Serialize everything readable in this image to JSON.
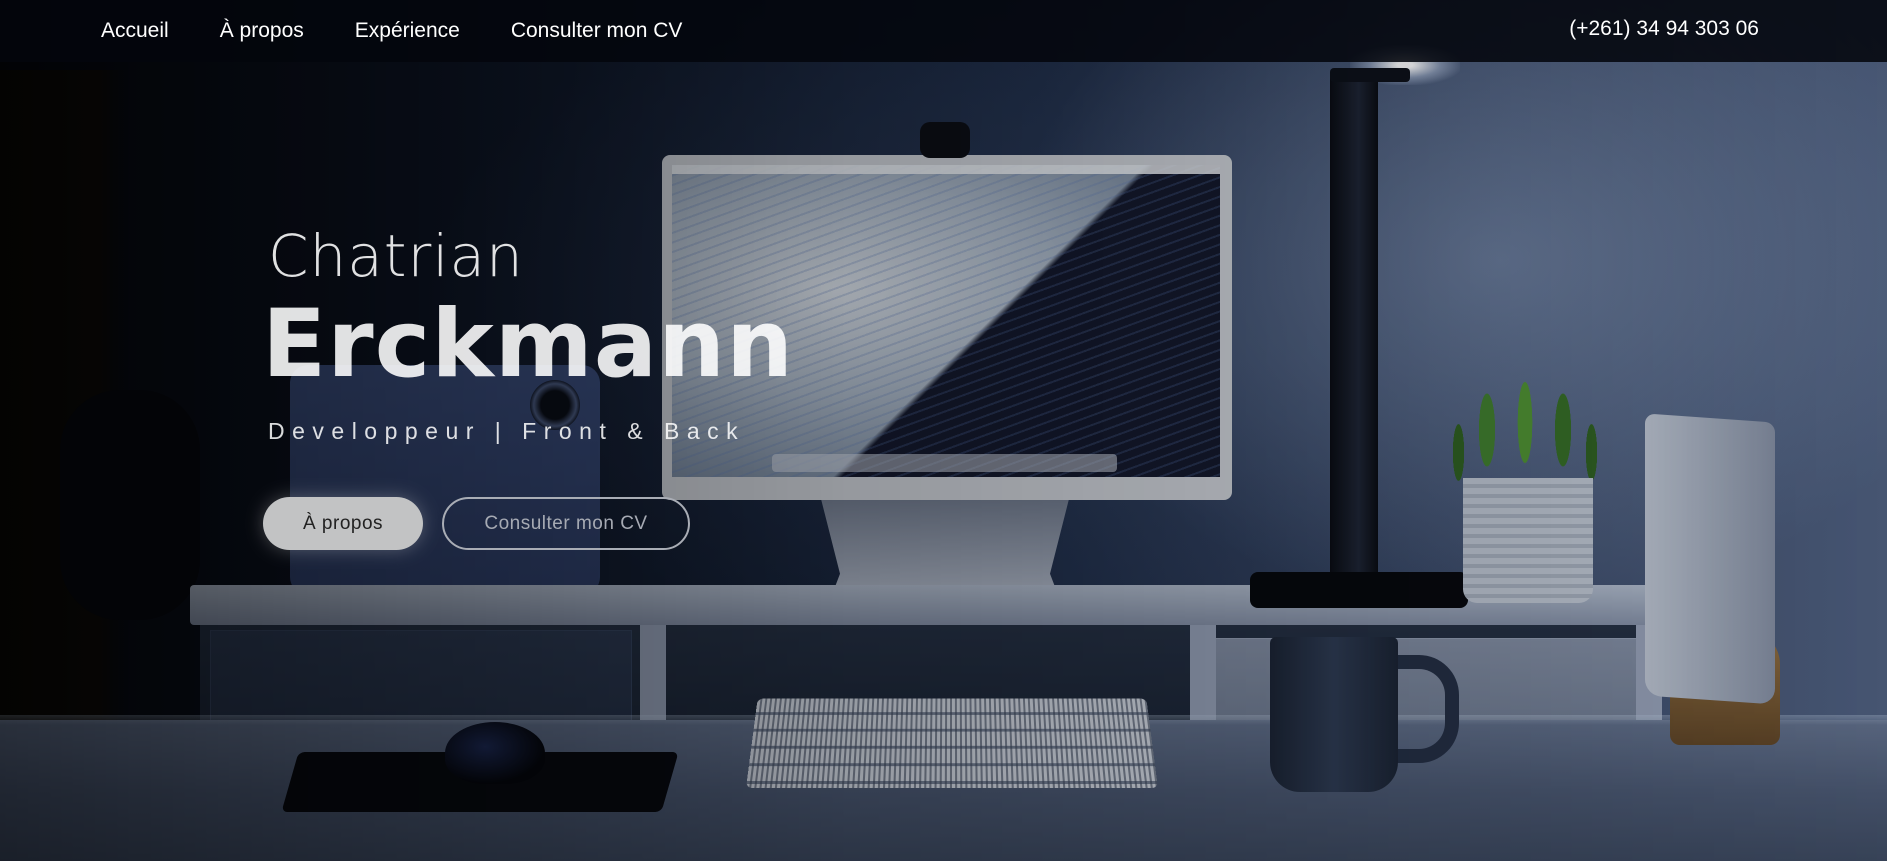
{
  "nav": {
    "items": [
      {
        "label": "Accueil"
      },
      {
        "label": "À propos"
      },
      {
        "label": "Expérience"
      },
      {
        "label": "Consulter mon CV"
      }
    ],
    "phone": "(+261) 34 94 303 06"
  },
  "hero": {
    "first_name": "Chatrian",
    "last_name": "Erckmann",
    "subtitle": "Developpeur | Front & Back",
    "primary_button": "À propos",
    "secondary_button": "Consulter mon CV"
  },
  "colors": {
    "nav_background": "#03060c",
    "text": "#ffffff",
    "primary_button_bg": "#c2c3c4",
    "outline_button_border": "#a9adb5"
  }
}
